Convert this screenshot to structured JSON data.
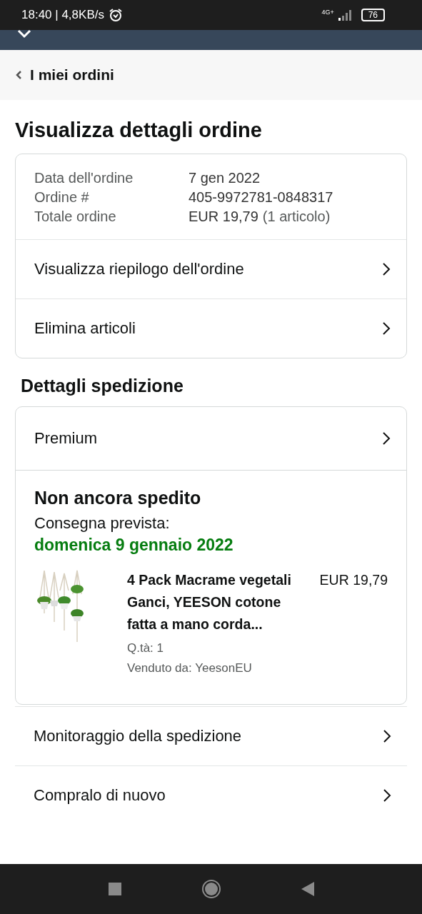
{
  "status_bar": {
    "time": "18:40 | 4,8KB/s",
    "network": "4G+",
    "battery": "76"
  },
  "back_link": {
    "label": "I miei ordini"
  },
  "title": "Visualizza dettagli ordine",
  "order_info": [
    {
      "label": "Data dell'ordine",
      "value": "7 gen 2022"
    },
    {
      "label": "Ordine #",
      "value": "405-9972781-0848317"
    },
    {
      "label": "Totale ordine",
      "value": "EUR 19,79",
      "note": "(1 articolo)"
    }
  ],
  "order_actions": [
    "Visualizza riepilogo dell'ordine",
    "Elimina articoli"
  ],
  "shipping": {
    "title": "Dettagli spedizione",
    "service": "Premium",
    "status": "Non ancora spedito",
    "delivery_label": "Consegna prevista:",
    "delivery_date": "domenica 9 gennaio 2022",
    "item": {
      "kind": "picture",
      "name": "4 Pack Macrame vegetali Ganci, YEESON cotone fatta a mano corda...",
      "price": "EUR 19,79",
      "quantity": "Q.tà: 1",
      "seller": "Venduto da: YeesonEU"
    }
  },
  "shipping_actions": [
    "Monitoraggio della spedizione",
    "Compralo di nuovo"
  ]
}
